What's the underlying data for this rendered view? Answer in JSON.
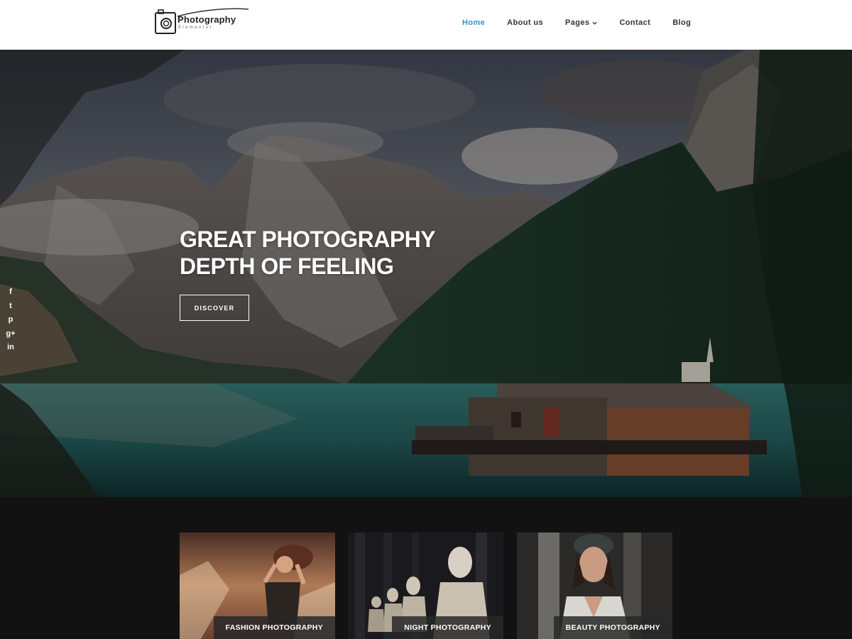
{
  "logo": {
    "title": "Photography",
    "subtitle": "Elementor"
  },
  "nav": {
    "items": [
      {
        "label": "Home",
        "active": true
      },
      {
        "label": "About us",
        "active": false
      },
      {
        "label": "Pages",
        "active": false,
        "has_dropdown": true
      },
      {
        "label": "Contact",
        "active": false
      },
      {
        "label": "Blog",
        "active": false
      }
    ]
  },
  "hero": {
    "title_line1": "GREAT PHOTOGRAPHY",
    "title_line2": "DEPTH OF FEELING",
    "button_label": "DISCOVER"
  },
  "social": [
    {
      "icon": "facebook-icon",
      "glyph": "f"
    },
    {
      "icon": "twitter-icon",
      "glyph": "t"
    },
    {
      "icon": "pinterest-icon",
      "glyph": "p"
    },
    {
      "icon": "google-plus-icon",
      "glyph": "g+"
    },
    {
      "icon": "linkedin-icon",
      "glyph": "in"
    }
  ],
  "cards": [
    {
      "label": "FASHION PHOTOGRAPHY"
    },
    {
      "label": "NIGHT PHOTOGRAPHY"
    },
    {
      "label": "BEAUTY PHOTOGRAPHY"
    }
  ],
  "colors": {
    "accent": "#3a8fc7",
    "dark_bg": "#131212",
    "header_bg": "#ffffff"
  }
}
